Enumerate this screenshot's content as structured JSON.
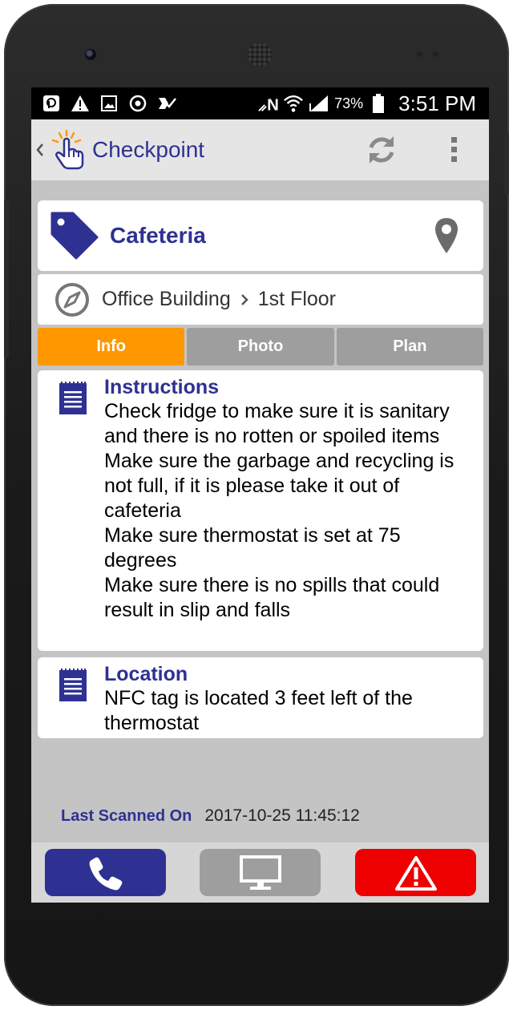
{
  "device": {
    "frame_color": "#1c1c1c"
  },
  "status_bar": {
    "battery": "73%",
    "time": "3:51 PM",
    "left_icons": [
      "pocket-icon",
      "warning-icon",
      "image-icon",
      "sync-circle-icon",
      "check-task-icon"
    ],
    "right_icons": [
      "nfc-icon",
      "wifi-icon",
      "signal-icon",
      "battery-icon"
    ]
  },
  "app_bar": {
    "title": "Checkpoint",
    "icons": [
      "back-chevron-icon",
      "app-logo-icon",
      "refresh-icon",
      "overflow-menu-icon"
    ]
  },
  "checkpoint": {
    "name": "Cafeteria",
    "path": [
      "Office Building",
      "1st Floor"
    ]
  },
  "tabs": [
    {
      "label": "Info",
      "active": true
    },
    {
      "label": "Photo",
      "active": false
    },
    {
      "label": "Plan",
      "active": false
    }
  ],
  "instructions": {
    "title": "Instructions",
    "lines": [
      "Check fridge to make sure it is sanitary and there is no rotten or spoiled items",
      "Make sure the garbage and recycling is not full, if it is please take it out of cafeteria",
      "Make sure thermostat is set at 75 degrees",
      "Make sure there is no spills that could result in slip and falls"
    ]
  },
  "location": {
    "title": "Location",
    "text": "NFC tag is located 3 feet left of the thermostat"
  },
  "last_scanned": {
    "label": "Last Scanned On",
    "value": "2017-10-25 11:45:12"
  },
  "bottom_buttons": [
    {
      "icon": "phone-icon",
      "color": "#2e3192"
    },
    {
      "icon": "monitor-icon",
      "color": "#9e9e9e"
    },
    {
      "icon": "alert-triangle-icon",
      "color": "#ee0000"
    }
  ],
  "colors": {
    "brand": "#2e3192",
    "active_tab": "#ff9800",
    "inactive_tab": "#9e9e9e",
    "alert": "#ee0000",
    "screen_bg": "#c4c4c4"
  }
}
